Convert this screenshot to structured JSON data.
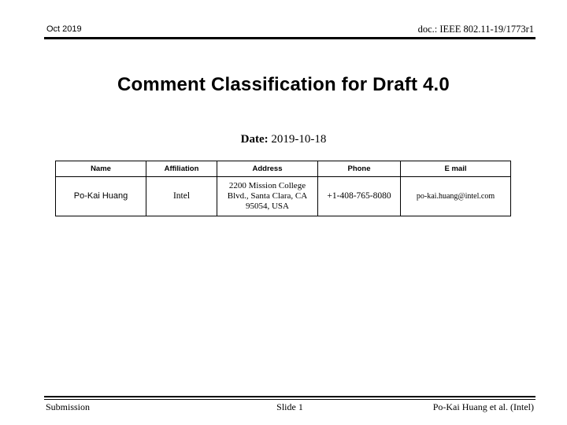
{
  "header": {
    "left": "Oct 2019",
    "right": "doc.: IEEE 802.11-19/1773r1"
  },
  "title": "Comment Classification for Draft 4.0",
  "date": {
    "label": "Date:",
    "value": "2019-10-18"
  },
  "author_table": {
    "columns": [
      "Name",
      "Affiliation",
      "Address",
      "Phone",
      "E mail"
    ],
    "rows": [
      {
        "name": "Po-Kai Huang",
        "affiliation": "Intel",
        "address": "2200 Mission College Blvd., Santa Clara, CA 95054, USA",
        "phone": "+1-408-765-8080",
        "email": "po-kai.huang@intel.com"
      }
    ]
  },
  "footer": {
    "left": "Submission",
    "center": "Slide 1",
    "right": "Po-Kai Huang et al. (Intel)"
  },
  "colors": {
    "text": "#000000",
    "background": "#ffffff",
    "rule": "#000000"
  }
}
